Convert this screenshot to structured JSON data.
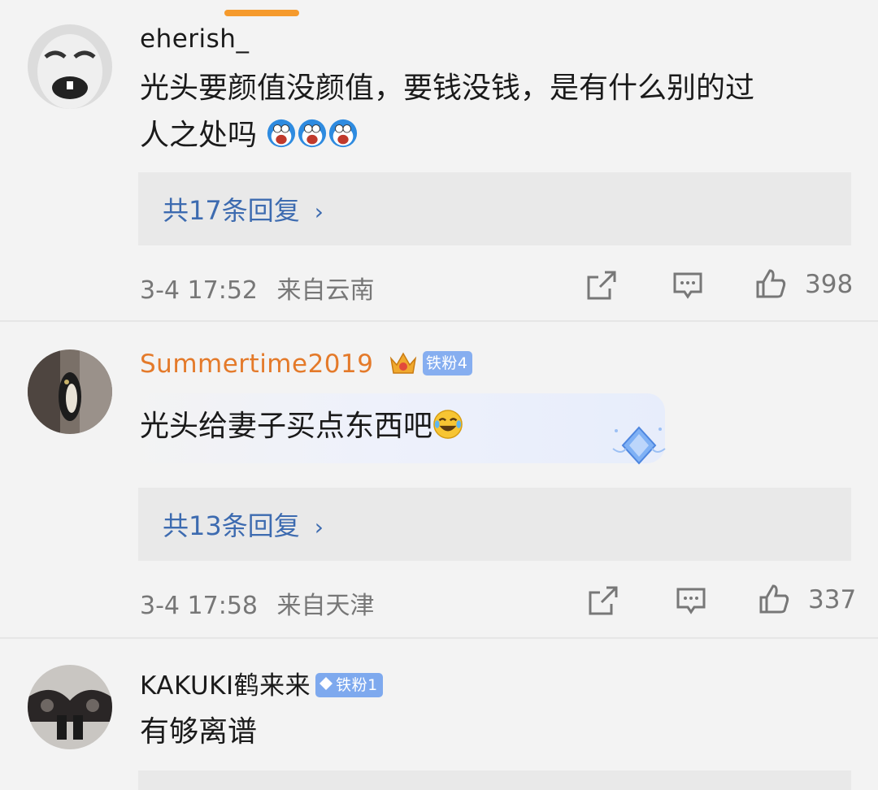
{
  "comments": [
    {
      "username": "eherish_",
      "text_line1": "光头要颜值没颜值，要钱没钱，是有什么别的过",
      "text_line2": "人之处吗",
      "emoji": "doraemon-cry-emoji",
      "replies_label": "共17条回复",
      "time": "3-4 17:52",
      "location": "来自云南",
      "likes": "398"
    },
    {
      "username": "Summertime2019",
      "username_color": "#e47a2a",
      "badge": "铁粉4",
      "text": "光头给妻子买点东西吧",
      "emoji": "laugh-cry-emoji",
      "replies_label": "共13条回复",
      "time": "3-4 17:58",
      "location": "来自天津",
      "likes": "337"
    },
    {
      "username": "KAKUKI鹤来来",
      "badge": "铁粉1",
      "text": "有够离谱"
    }
  ],
  "colors": {
    "accent": "#f59a2c",
    "link": "#3d6bb0",
    "meta": "#777777"
  }
}
